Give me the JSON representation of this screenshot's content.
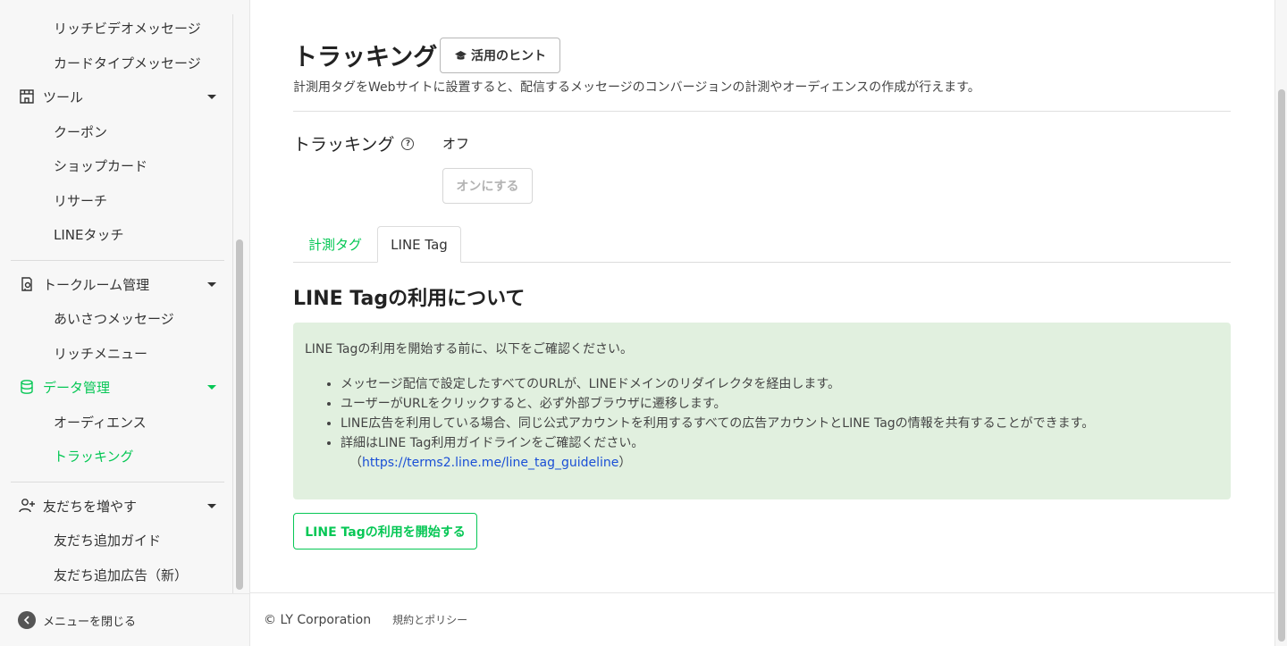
{
  "sidebar": {
    "items": [
      {
        "label": "リッチビデオメッセージ"
      },
      {
        "label": "カードタイプメッセージ"
      },
      {
        "label": "ツール"
      },
      {
        "label": "クーポン"
      },
      {
        "label": "ショップカード"
      },
      {
        "label": "リサーチ"
      },
      {
        "label": "LINEタッチ"
      },
      {
        "label": "トークルーム管理"
      },
      {
        "label": "あいさつメッセージ"
      },
      {
        "label": "リッチメニュー"
      },
      {
        "label": "データ管理"
      },
      {
        "label": "オーディエンス"
      },
      {
        "label": "トラッキング"
      },
      {
        "label": "友だちを増やす"
      },
      {
        "label": "友だち追加ガイド"
      },
      {
        "label": "友だち追加広告（新）"
      }
    ],
    "close_label": "メニューを閉じる"
  },
  "main": {
    "title": "トラッキング",
    "hint_label": "活用のヒント",
    "description": "計測用タグをWebサイトに設置すると、配信するメッセージのコンバージョンの計測やオーディエンスの作成が行えます。",
    "tracking_label": "トラッキング",
    "tracking_status": "オフ",
    "toggle_label": "オンにする",
    "tabs": [
      {
        "label": "計測タグ"
      },
      {
        "label": "LINE Tag"
      }
    ],
    "section_title": "LINE Tagの利用について",
    "info": {
      "intro": "LINE Tagの利用を開始する前に、以下をご確認ください。",
      "bullets": [
        "メッセージ配信で設定したすべてのURLが、LINEドメインのリダイレクタを経由します。",
        "ユーザーがURLをクリックすると、必ず外部ブラウザに遷移します。",
        "LINE広告を利用している場合、同じ公式アカウントを利用するすべての広告アカウントとLINE Tagの情報を共有することができます。",
        "詳細はLINE Tag利用ガイドラインをご確認ください。"
      ],
      "link_open": "（",
      "link_text": "https://terms2.line.me/line_tag_guideline",
      "link_close": "）"
    },
    "start_label": "LINE Tagの利用を開始する"
  },
  "footer": {
    "copyright": "© LY Corporation",
    "links": "規約とポリシー"
  },
  "colors": {
    "accent": "#06c755",
    "info_bg": "#e1f0df",
    "link": "#1a4fd6"
  }
}
